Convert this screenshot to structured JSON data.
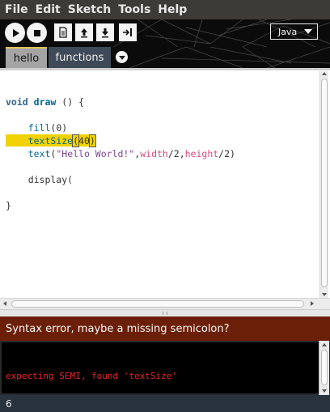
{
  "menu": {
    "items": [
      "File",
      "Edit",
      "Sketch",
      "Tools",
      "Help"
    ]
  },
  "toolbar": {
    "buttons": [
      "play-icon",
      "stop-icon",
      "new-icon",
      "open-icon",
      "save-icon",
      "export-icon"
    ],
    "mode": "Java"
  },
  "tabs": {
    "items": [
      {
        "label": "hello",
        "active": true
      },
      {
        "label": "functions",
        "active": false
      }
    ],
    "menu_icon": "chevron-down-icon"
  },
  "editor": {
    "lines": [
      "",
      "void draw () {",
      "",
      "    fill(0)",
      "    textSize(40)",
      "    text(\"Hello World!\",width/2,height/2)",
      "",
      "    display(",
      "",
      "}"
    ],
    "highlighted_line": 4
  },
  "status": {
    "message": "Syntax error, maybe a missing semicolon?"
  },
  "console": {
    "lines": [
      "expecting SEMI, found 'textSize'"
    ]
  },
  "line_status": {
    "line_number": "6"
  },
  "colors": {
    "menubar": "#3c3b37",
    "error_bar": "#6b1f08",
    "highlight": "#f1d200",
    "console_error": "#e8232a",
    "footer": "#29333d"
  }
}
